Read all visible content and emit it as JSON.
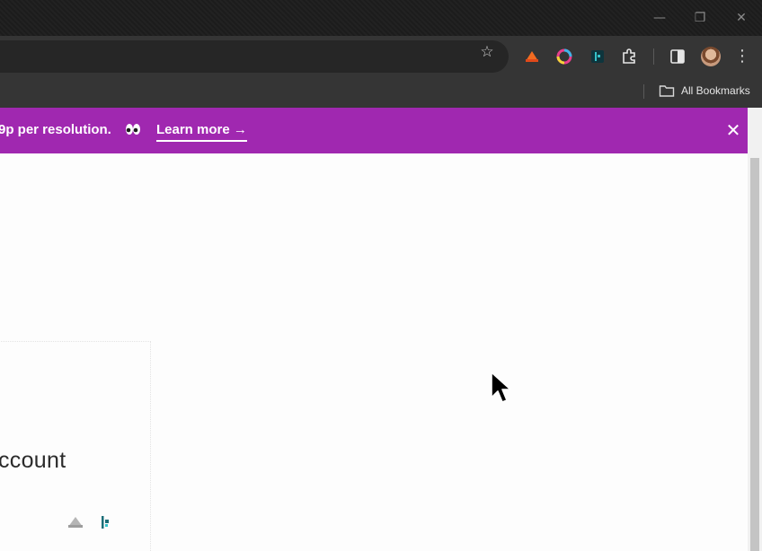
{
  "window": {
    "minimize_glyph": "—",
    "restore_glyph": "❐",
    "close_glyph": "✕"
  },
  "toolbar": {
    "star_icon": "star-icon",
    "menu_glyph": "⋮",
    "extensions": [
      "shape-extension-icon",
      "color-ring-extension-icon",
      "dashlane-extension-icon",
      "puzzle-icon"
    ]
  },
  "bookmarks": {
    "all_bookmarks_label": "All Bookmarks"
  },
  "banner": {
    "text": "9p per resolution.",
    "learn_more_label": "Learn more →",
    "close_glyph": "✕",
    "background_color": "#a028b0"
  },
  "main": {
    "card_title": "ccount"
  }
}
